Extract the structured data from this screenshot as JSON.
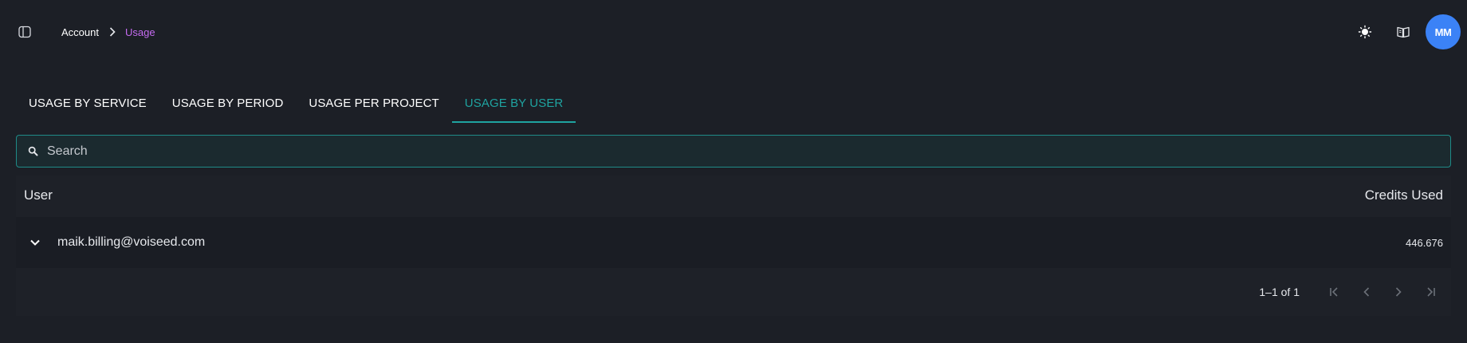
{
  "breadcrumb": {
    "root": "Account",
    "current": "Usage"
  },
  "header": {
    "avatar_initials": "MM"
  },
  "tabs": [
    {
      "label": "USAGE BY SERVICE",
      "active": false
    },
    {
      "label": "USAGE BY PERIOD",
      "active": false
    },
    {
      "label": "USAGE PER PROJECT",
      "active": false
    },
    {
      "label": "USAGE BY USER",
      "active": true
    }
  ],
  "search": {
    "placeholder": "Search",
    "value": ""
  },
  "table": {
    "columns": [
      "User",
      "Credits Used"
    ],
    "rows": [
      {
        "user": "maik.billing@voiseed.com",
        "credits": "446.676"
      }
    ]
  },
  "pagination": {
    "range_label": "1–1 of 1"
  },
  "colors": {
    "accent": "#1fa3a0",
    "breadcrumb_active": "#c46bf0",
    "avatar_bg": "#3b82f6",
    "background": "#1c1f26"
  },
  "icons": [
    "sidebar-toggle-icon",
    "chevron-right-icon",
    "sun-icon",
    "book-icon",
    "search-icon",
    "chevron-down-icon",
    "first-page-icon",
    "previous-page-icon",
    "next-page-icon",
    "last-page-icon"
  ]
}
